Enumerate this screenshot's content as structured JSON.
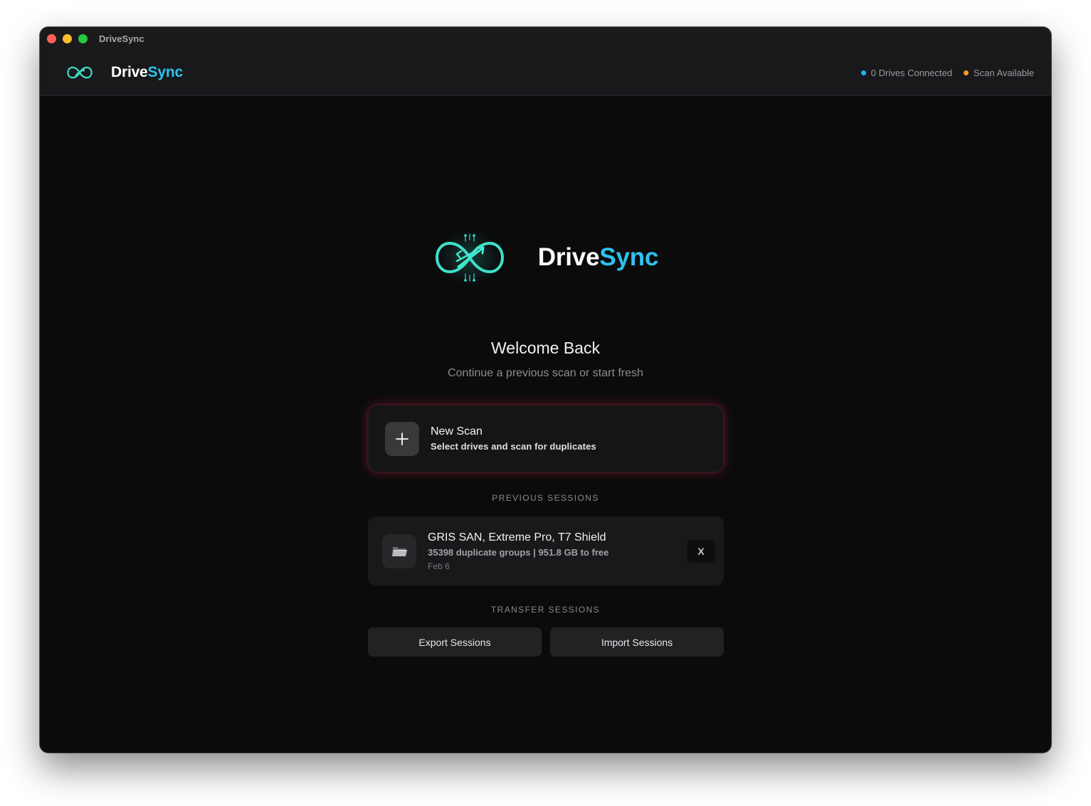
{
  "window": {
    "title": "DriveSync"
  },
  "header": {
    "brand_part1": "Drive",
    "brand_part2": "Sync",
    "status": [
      {
        "label": "0 Drives Connected",
        "color": "#1fb4f0"
      },
      {
        "label": "Scan Available",
        "color": "#f59a23"
      }
    ]
  },
  "hero": {
    "brand_part1": "Drive",
    "brand_part2": "Sync",
    "logo_icon": "infinity-sync-icon"
  },
  "welcome": {
    "title": "Welcome Back",
    "subtitle": "Continue a previous scan or start fresh"
  },
  "new_scan": {
    "icon": "plus-icon",
    "title": "New Scan",
    "subtitle": "Select drives and scan for duplicates"
  },
  "previous_sessions": {
    "label": "PREVIOUS SESSIONS",
    "items": [
      {
        "icon": "folder-icon",
        "title": "GRIS SAN, Extreme Pro, T7 Shield",
        "stats": "35398 duplicate groups | 951.8 GB to free",
        "date": "Feb 6",
        "remove_label": "X"
      }
    ]
  },
  "transfer_sessions": {
    "label": "TRANSFER SESSIONS",
    "export_label": "Export Sessions",
    "import_label": "Import Sessions"
  },
  "colors": {
    "accent": "#2cc3ee",
    "logo_teal": "#3fe0c8",
    "new_scan_glow": "#ff2d55"
  }
}
